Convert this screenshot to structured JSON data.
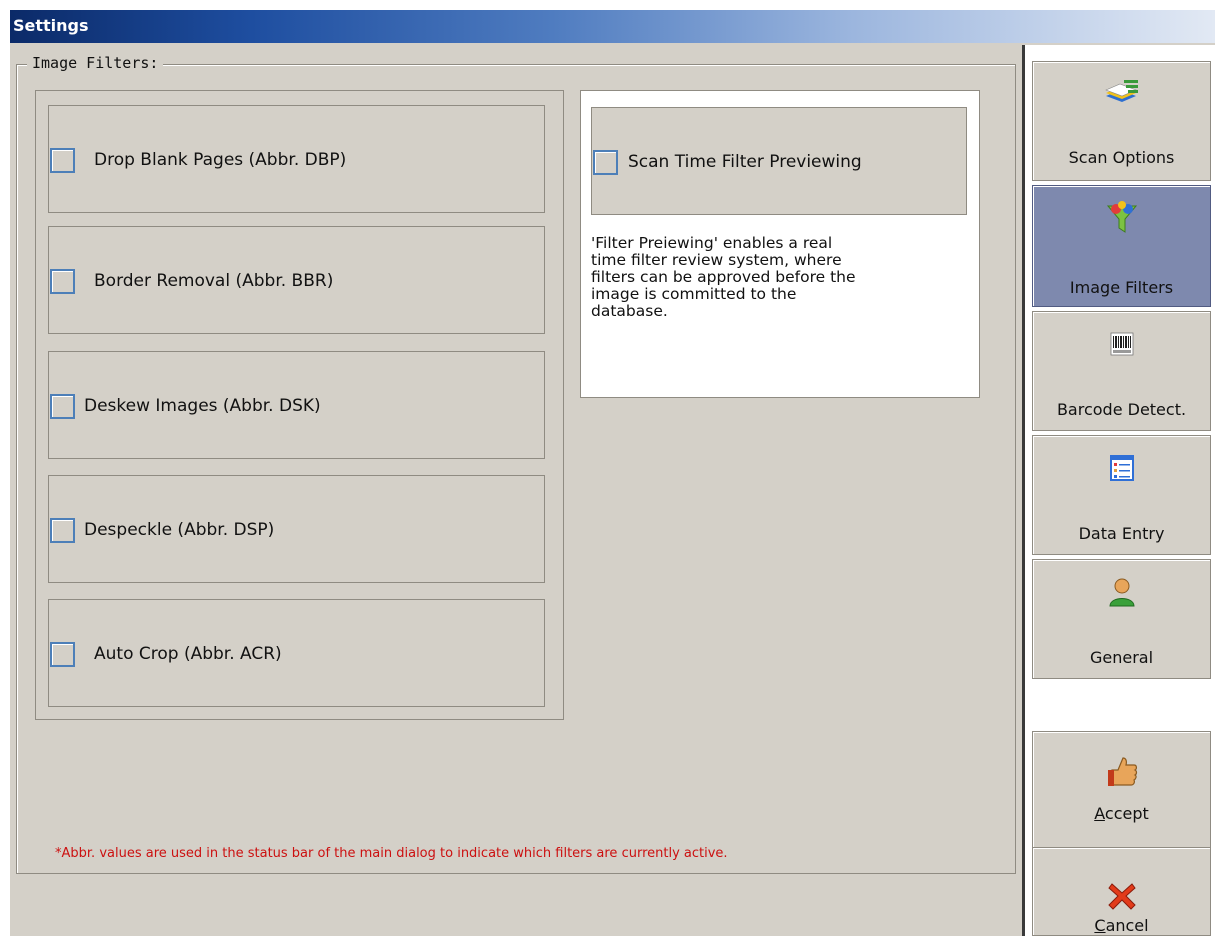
{
  "window": {
    "title": "Settings"
  },
  "group": {
    "title": "Image Filters:"
  },
  "filters": [
    {
      "label": "Drop Blank Pages (Abbr. DBP)",
      "checked": false
    },
    {
      "label": "Border Removal (Abbr. BBR)",
      "checked": false
    },
    {
      "label": "Deskew Images (Abbr. DSK)",
      "checked": false
    },
    {
      "label": "Despeckle (Abbr. DSP)",
      "checked": false
    },
    {
      "label": "Auto Crop (Abbr. ACR)",
      "checked": false
    }
  ],
  "preview": {
    "label": "Scan Time Filter Previewing",
    "checked": false,
    "description": "'Filter Preiewing'  enables a real\ntime filter review system, where\nfilters can be approved before the\nimage is committed to the\ndatabase."
  },
  "footnote": "*Abbr. values are used in the status bar of the main dialog to indicate which filters are currently active.",
  "sidebar": {
    "items": [
      {
        "label": "Scan Options",
        "icon": "scan-options-icon",
        "active": false
      },
      {
        "label": "Image Filters",
        "icon": "funnel-icon",
        "active": true
      },
      {
        "label": "Barcode Detect.",
        "icon": "barcode-icon",
        "active": false
      },
      {
        "label": "Data Entry",
        "icon": "form-list-icon",
        "active": false
      },
      {
        "label": "General",
        "icon": "user-icon",
        "active": false
      }
    ],
    "accept": {
      "label": "Accept",
      "icon": "thumbs-up-icon"
    },
    "cancel": {
      "label": "Cancel",
      "icon": "red-x-icon"
    }
  },
  "colors": {
    "accent_active": "#7e89ae",
    "checkbox_border": "#4d7fb8",
    "footnote": "#cc1010"
  }
}
